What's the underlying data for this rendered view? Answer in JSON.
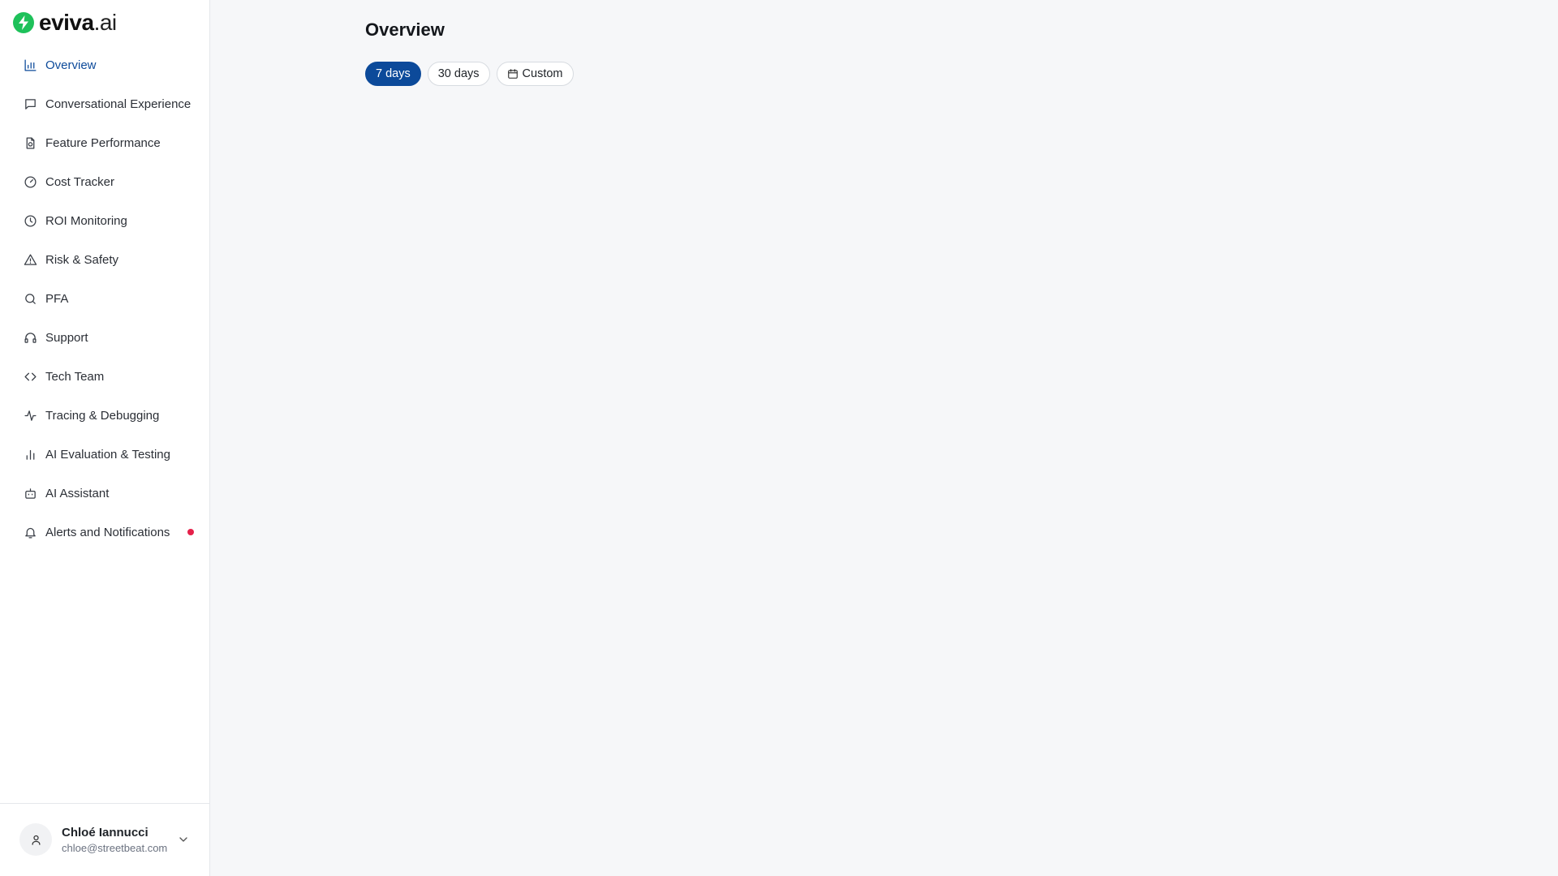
{
  "brand": {
    "name": "eviva",
    "suffix": ".ai",
    "color": "#1ec15a"
  },
  "sidebar": {
    "items": [
      {
        "label": "Overview",
        "icon": "bar-chart-icon",
        "active": true
      },
      {
        "label": "Conversational Experience",
        "icon": "message-square-icon"
      },
      {
        "label": "Feature Performance",
        "icon": "file-chart-icon"
      },
      {
        "label": "Cost Tracker",
        "icon": "gauge-icon"
      },
      {
        "label": "ROI Monitoring",
        "icon": "clock-icon"
      },
      {
        "label": "Risk & Safety",
        "icon": "alert-triangle-icon"
      },
      {
        "label": "PFA",
        "icon": "search-icon"
      },
      {
        "label": "Support",
        "icon": "headphones-icon"
      },
      {
        "label": "Tech Team",
        "icon": "code-icon"
      },
      {
        "label": "Tracing & Debugging",
        "icon": "activity-icon"
      },
      {
        "label": "AI Evaluation & Testing",
        "icon": "bar-chart-2-icon"
      },
      {
        "label": "AI Assistant",
        "icon": "bot-icon"
      },
      {
        "label": "Alerts and Notifications",
        "icon": "bell-icon",
        "badge": true
      }
    ]
  },
  "user": {
    "name": "Chloé Iannucci",
    "email": "chloe@streetbeat.com"
  },
  "main": {
    "title": "Overview",
    "ranges": [
      {
        "label": "7 days",
        "selected": true
      },
      {
        "label": "30 days"
      },
      {
        "label": "Custom",
        "icon": "calendar-icon"
      }
    ]
  },
  "colors": {
    "accent": "#0c4a9a",
    "badge": "#e5214a",
    "background": "#f6f7f9"
  }
}
